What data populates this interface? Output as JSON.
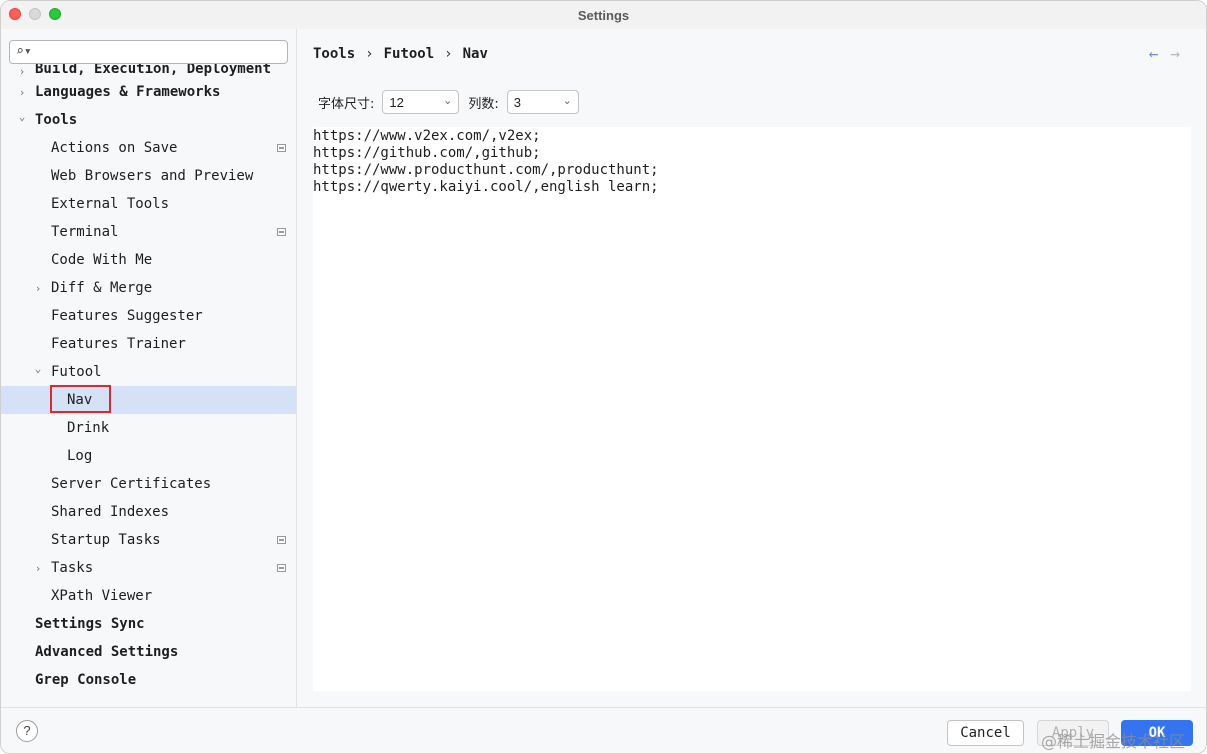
{
  "window": {
    "title": "Settings"
  },
  "sidebar": {
    "search_placeholder": "",
    "items": [
      {
        "label": "Build, Execution, Deployment",
        "bold": true,
        "level": 0,
        "arrow": "right"
      },
      {
        "label": "Languages & Frameworks",
        "bold": true,
        "level": 0,
        "arrow": "right"
      },
      {
        "label": "Tools",
        "bold": true,
        "level": 0,
        "arrow": "down"
      },
      {
        "label": "Actions on Save",
        "level": 1,
        "project_icon": true
      },
      {
        "label": "Web Browsers and Preview",
        "level": 1
      },
      {
        "label": "External Tools",
        "level": 1
      },
      {
        "label": "Terminal",
        "level": 1,
        "project_icon": true
      },
      {
        "label": "Code With Me",
        "level": 1
      },
      {
        "label": "Diff & Merge",
        "level": 1,
        "arrow": "right"
      },
      {
        "label": "Features Suggester",
        "level": 1
      },
      {
        "label": "Features Trainer",
        "level": 1
      },
      {
        "label": "Futool",
        "level": 1,
        "arrow": "down"
      },
      {
        "label": "Nav",
        "level": 2,
        "selected": true
      },
      {
        "label": "Drink",
        "level": 2
      },
      {
        "label": "Log",
        "level": 2
      },
      {
        "label": "Server Certificates",
        "level": 1
      },
      {
        "label": "Shared Indexes",
        "level": 1
      },
      {
        "label": "Startup Tasks",
        "level": 1,
        "project_icon": true
      },
      {
        "label": "Tasks",
        "level": 1,
        "arrow": "right",
        "project_icon": true
      },
      {
        "label": "XPath Viewer",
        "level": 1
      },
      {
        "label": "Settings Sync",
        "bold": true,
        "level": 0
      },
      {
        "label": "Advanced Settings",
        "bold": true,
        "level": 0
      },
      {
        "label": "Grep Console",
        "bold": true,
        "level": 0
      }
    ]
  },
  "breadcrumb": {
    "items": [
      "Tools",
      "Futool",
      "Nav"
    ],
    "separator": "›"
  },
  "nav_arrows": {
    "back": "←",
    "forward": "→"
  },
  "options": {
    "font_size_label": "字体尺寸:",
    "font_size_value": "12",
    "columns_label": "列数:",
    "columns_value": "3"
  },
  "editor": {
    "lines": [
      "https://www.v2ex.com/,v2ex;",
      "https://github.com/,github;",
      "https://www.producthunt.com/,producthunt;",
      "https://qwerty.kaiyi.cool/,english learn;"
    ]
  },
  "footer": {
    "help": "?",
    "cancel": "Cancel",
    "apply": "Apply",
    "ok": "OK",
    "watermark": "@稀土掘金技术社区"
  },
  "colors": {
    "accent": "#3574f0",
    "selected_row": "#d5e1f6",
    "highlight_box": "#e0262e"
  }
}
